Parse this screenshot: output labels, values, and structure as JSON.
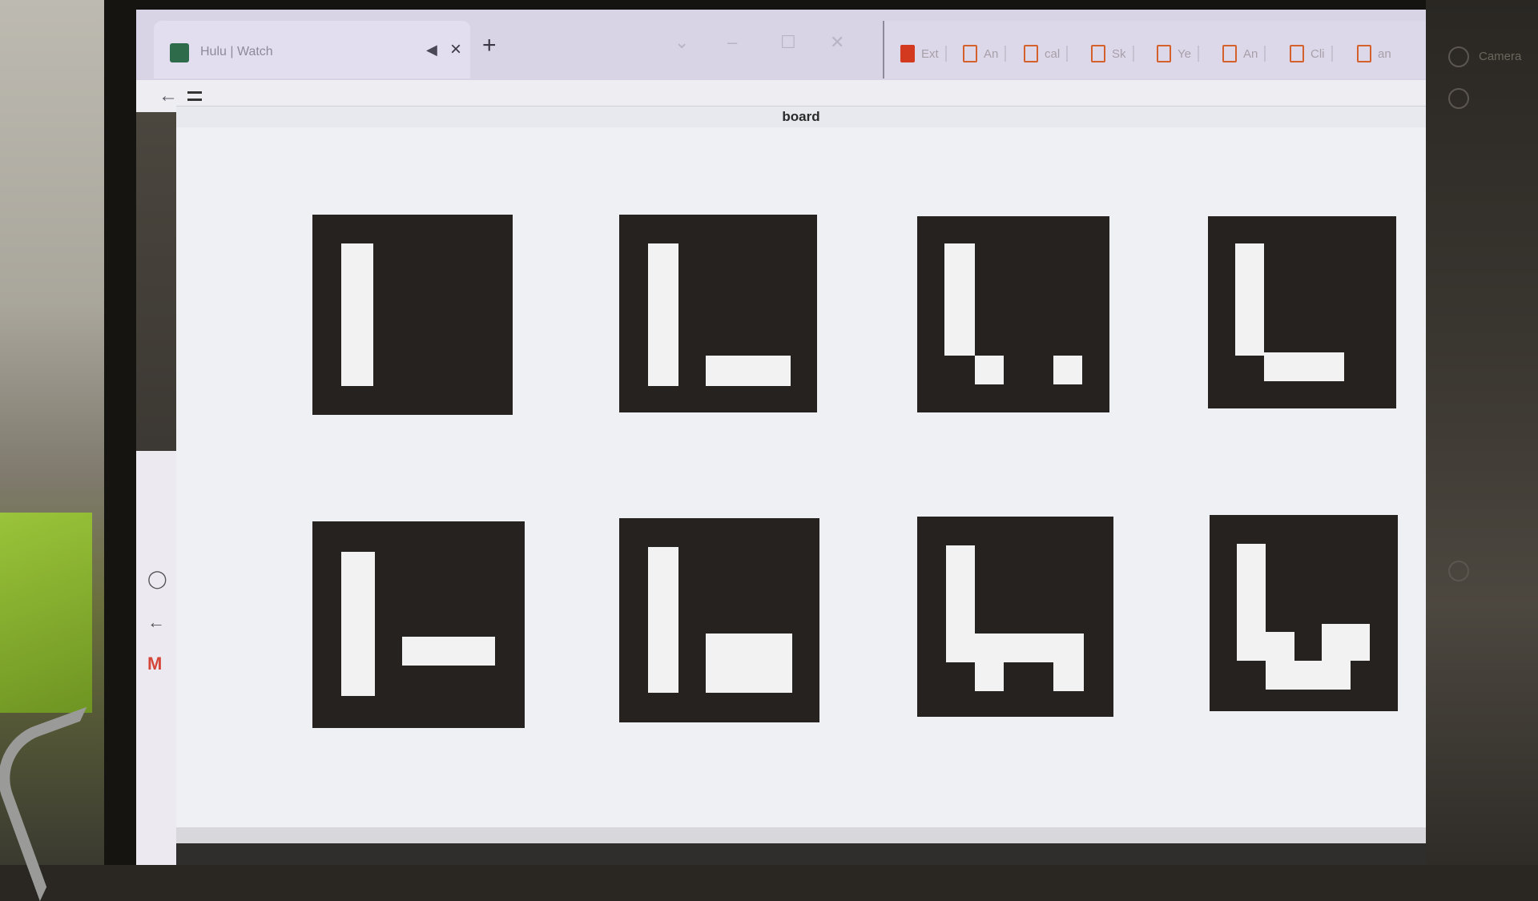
{
  "browser": {
    "tab_title": "Hulu | Watch",
    "tab_mute_icon": "speaker-icon",
    "tab_close_icon": "close-icon",
    "new_tab_label": "+",
    "window_controls": [
      "chevron-down-icon",
      "minimize-icon",
      "maximize-icon",
      "close-icon"
    ],
    "bookmarks": [
      "Ext",
      "An",
      "cal",
      "Sk",
      "Ye",
      "An",
      "Cli",
      "an"
    ]
  },
  "toolbar": {
    "back_icon": "back-arrow-icon",
    "menu_icon": "menu-icon"
  },
  "side_strip": {
    "icons": [
      "github-icon",
      "back-arrow-icon",
      "gmail-icon"
    ]
  },
  "right_panel": {
    "label": "Camera"
  },
  "board": {
    "title": "board",
    "markers": [
      {
        "name": "marker-1"
      },
      {
        "name": "marker-2"
      },
      {
        "name": "marker-3"
      },
      {
        "name": "marker-4"
      },
      {
        "name": "marker-5"
      },
      {
        "name": "marker-6"
      },
      {
        "name": "marker-7"
      },
      {
        "name": "marker-8"
      }
    ]
  },
  "colors": {
    "marker_black": "#262220",
    "marker_white": "#f2f2f2",
    "window_bg": "#eef0f4",
    "tabbar": "#d8d4e6"
  }
}
